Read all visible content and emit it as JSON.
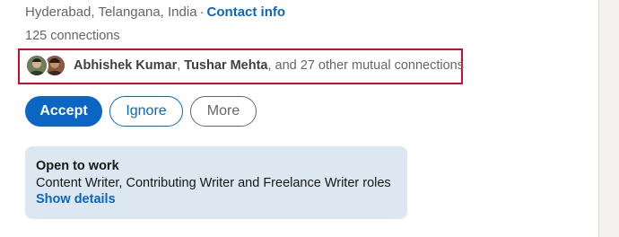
{
  "profile": {
    "location": "Hyderabad, Telangana, India",
    "separator": "·",
    "contact_info_label": "Contact info",
    "connections_text": "125 connections"
  },
  "mutual": {
    "name1": "Abhishek Kumar",
    "comma": ",",
    "name2": "Tushar Mehta",
    "rest_text": ", and 27 other mutual connections",
    "highlight_color": "#c8102e"
  },
  "actions": {
    "accept_label": "Accept",
    "ignore_label": "Ignore",
    "more_label": "More"
  },
  "open_to_work": {
    "title": "Open to work",
    "roles": "Content Writer, Contributing Writer and Freelance Writer roles",
    "link_label": "Show details"
  },
  "colors": {
    "primary": "#0a66c2",
    "muted_text": "#666666",
    "otw_background": "#dde7f1"
  },
  "icons": {
    "avatar1": "person-avatar-icon",
    "avatar2": "person-avatar-icon"
  }
}
